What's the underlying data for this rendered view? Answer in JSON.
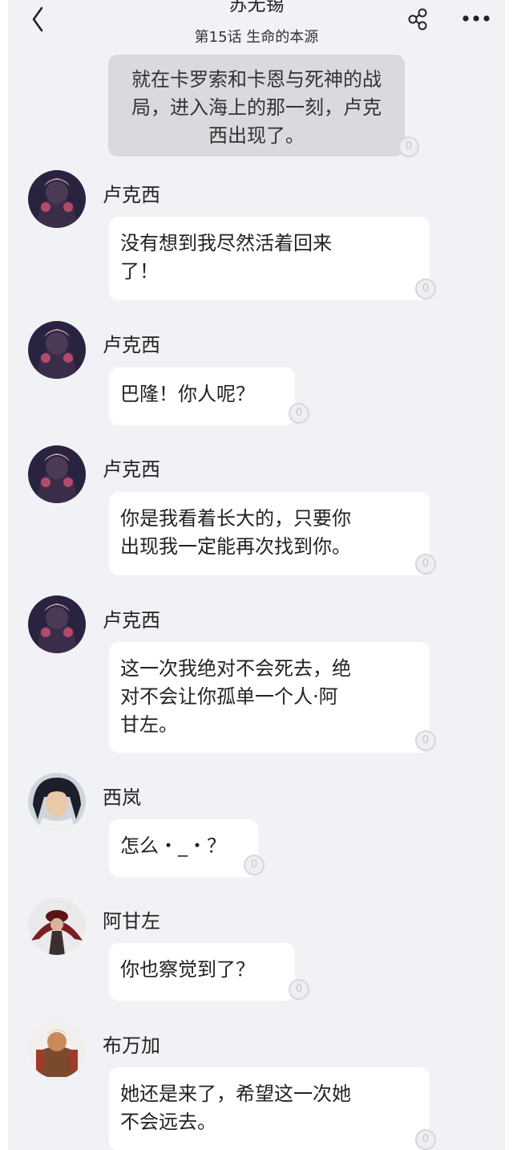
{
  "header": {
    "title": "苏无锡",
    "subtitle": "第15话  生命的本源"
  },
  "narration": {
    "text": "就在卡罗索和卡恩与死神的战局，进入海上的那一刻，卢克西出现了。",
    "count": "0"
  },
  "messages": [
    {
      "sender": "卢克西",
      "text": "没有想到我尽然活着回来\n了！",
      "count": "0",
      "avatar": "luxi-avatar"
    },
    {
      "sender": "卢克西",
      "text": "巴隆！你人呢？",
      "count": "0",
      "avatar": "luxi-avatar"
    },
    {
      "sender": "卢克西",
      "text": "你是我看着长大的，只要你\n出现我一定能再次找到你。",
      "count": "0",
      "avatar": "luxi-avatar"
    },
    {
      "sender": "卢克西",
      "text": "这一次我绝对不会死去，绝\n对不会让你孤单一个人·阿\n甘左。",
      "count": "0",
      "avatar": "luxi-avatar"
    },
    {
      "sender": "西岚",
      "text": "怎么・_・？",
      "count": "0",
      "avatar": "xilan-avatar"
    },
    {
      "sender": "阿甘左",
      "text": "你也察觉到了？",
      "count": "0",
      "avatar": "aganzuo-avatar"
    },
    {
      "sender": "布万加",
      "text": "她还是来了，希望这一次她\n不会远去。",
      "count": "0",
      "avatar": "buwanjia-avatar"
    }
  ]
}
